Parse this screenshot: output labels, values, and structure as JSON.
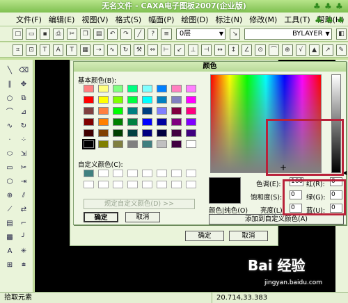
{
  "window": {
    "title": "无名文件 - CAXA电子图板2007(企业版)"
  },
  "menu": [
    "文件(F)",
    "编辑(E)",
    "视图(V)",
    "格式(S)",
    "幅面(P)",
    "绘图(D)",
    "标注(N)",
    "修改(M)",
    "工具(T)",
    "帮助(H)"
  ],
  "toolbar": {
    "layer": "0层",
    "linetype": "BYLAYER"
  },
  "dialog": {
    "title": "颜色",
    "basic_label": "基本颜色(B):",
    "basic_colors": [
      "#ff8080",
      "#ffff80",
      "#80ff80",
      "#00ff80",
      "#80ffff",
      "#0080ff",
      "#ff80c0",
      "#ff80ff",
      "#ff0000",
      "#ffff00",
      "#80ff00",
      "#00ff40",
      "#00ffff",
      "#0080c0",
      "#8080c0",
      "#ff00ff",
      "#804040",
      "#ff8040",
      "#00ff00",
      "#008080",
      "#004080",
      "#8080ff",
      "#800040",
      "#ff0080",
      "#800000",
      "#ff8000",
      "#008000",
      "#008040",
      "#0000ff",
      "#0000a0",
      "#800080",
      "#8000ff",
      "#400000",
      "#804000",
      "#004000",
      "#004040",
      "#000080",
      "#000040",
      "#400040",
      "#400080",
      "#000000",
      "#808000",
      "#808040",
      "#808080",
      "#408080",
      "#c0c0c0",
      "#400040",
      "#ffffff"
    ],
    "custom_label": "自定义颜色(C):",
    "custom_colors": [
      "#408080"
    ],
    "define_custom_label": "规定自定义颜色(D) >>",
    "ok_label": "确定",
    "cancel_label": "取消",
    "color_solid_label": "颜色|纯色(O)",
    "hue_label": "色调(E):",
    "hue_value": "160",
    "sat_label": "饱和度(S):",
    "sat_value": "0",
    "lum_label": "亮度(L):",
    "lum_value": "0",
    "red_label": "红(R):",
    "red_value": "0",
    "green_label": "绿(G):",
    "green_value": "0",
    "blue_label": "蓝(U):",
    "blue_value": "0",
    "add_custom_label": "添加到自定义颜色(A)"
  },
  "outer": {
    "ok_label": "确定",
    "cancel_label": "取消"
  },
  "status": {
    "prompt": "拾取元素",
    "coords": "20.714,33.383"
  },
  "watermark": {
    "text": "Bai 经验",
    "sub": "jingyan.baidu.com"
  }
}
